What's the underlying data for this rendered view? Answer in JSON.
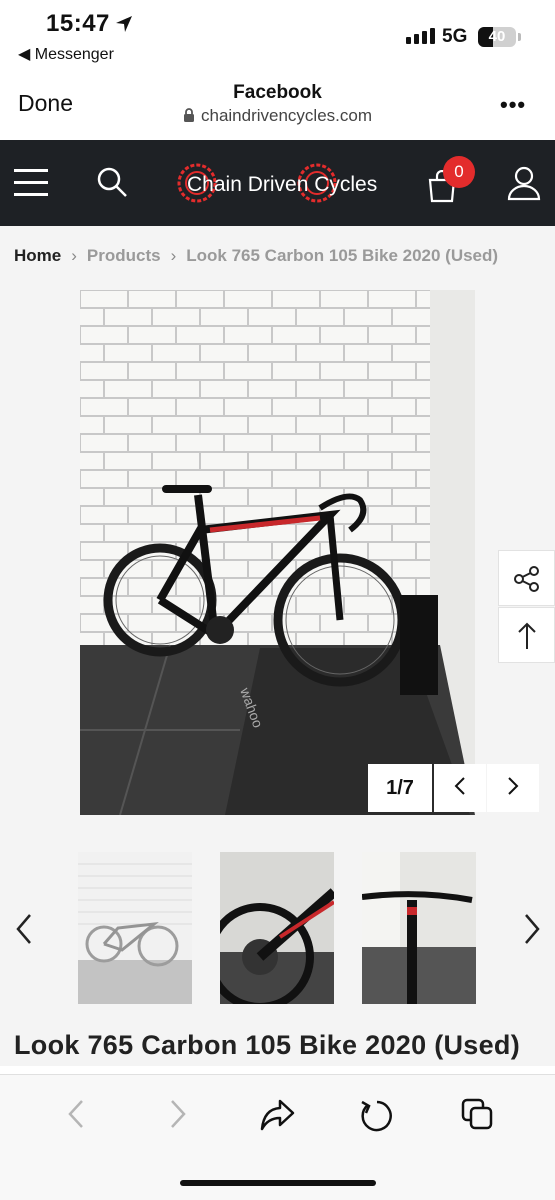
{
  "status_bar": {
    "time": "15:47",
    "back_app": "◀ Messenger",
    "network": "5G",
    "battery": "40"
  },
  "browser": {
    "done_label": "Done",
    "title": "Facebook",
    "url": "chaindrivencycles.com",
    "more_label": "•••"
  },
  "site_nav": {
    "logo_text": "Chain Driven Cycles",
    "cart_count": "0"
  },
  "breadcrumb": {
    "home": "Home",
    "products": "Products",
    "current": "Look 765 Carbon 105 Bike 2020 (Used)"
  },
  "gallery": {
    "counter": "1/7"
  },
  "product": {
    "title": "Look 765 Carbon 105 Bike 2020 (Used)"
  },
  "colors": {
    "nav_bg": "#1e2125",
    "accent_red": "#e32c2c",
    "page_bg": "#f4f4f4"
  }
}
